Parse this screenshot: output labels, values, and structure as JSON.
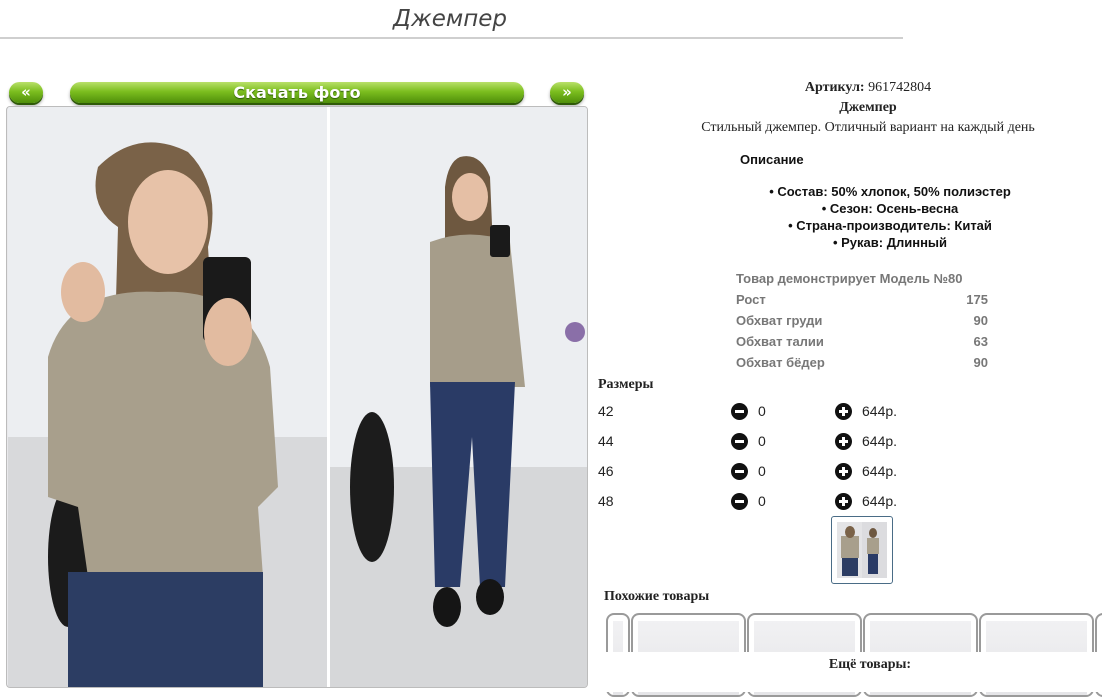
{
  "page": {
    "title": "Джемпер"
  },
  "gallery": {
    "prev_label": "«",
    "next_label": "»",
    "download_label": "Скачать фото"
  },
  "product": {
    "article_label": "Артикул:",
    "article_value": "961742804",
    "name": "Джемпер",
    "tagline": "Стильный джемпер. Отличный вариант на каждый день",
    "description_title": "Описание",
    "properties": [
      "• Состав: 50% хлопок, 50% полиэстер",
      "• Сезон: Осень-весна",
      "• Страна-производитель: Китай",
      "• Рукав: Длинный"
    ],
    "model_heading": "Товар демонстрирует Модель №80",
    "model_params": [
      {
        "label": "Рост",
        "value": "175"
      },
      {
        "label": "Обхват груди",
        "value": "90"
      },
      {
        "label": "Обхват талии",
        "value": "63"
      },
      {
        "label": "Обхват бёдер",
        "value": "90"
      }
    ]
  },
  "sizes": {
    "title": "Размеры",
    "rows": [
      {
        "size": "42",
        "qty": "0",
        "price": "644р."
      },
      {
        "size": "44",
        "qty": "0",
        "price": "644р."
      },
      {
        "size": "46",
        "qty": "0",
        "price": "644р."
      },
      {
        "size": "48",
        "qty": "0",
        "price": "644р."
      }
    ]
  },
  "similar": {
    "title": "Похожие товары"
  },
  "more": {
    "title": "Ещё товары:"
  },
  "colors": {
    "accent_green": "#6aae16",
    "model_text": "#777777"
  },
  "icons": [
    "minus-circle-icon",
    "plus-circle-icon",
    "chevron-left-icon",
    "chevron-right-icon"
  ]
}
